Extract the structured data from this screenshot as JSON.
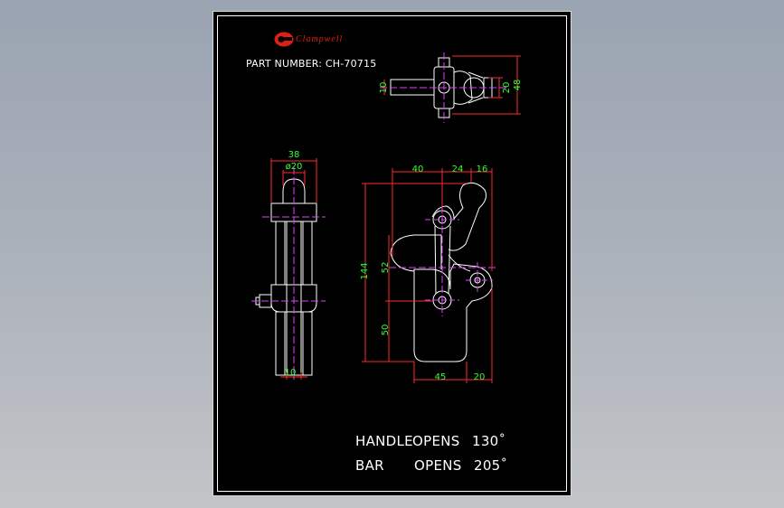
{
  "brand": {
    "name": "Clampwell",
    "color": "#e01f14"
  },
  "drawing": {
    "part_number_label": "PART NUMBER: CH-70715",
    "notes": [
      {
        "label": "HANDLE",
        "verb": "OPENS",
        "angle": "130˚"
      },
      {
        "label": "BAR",
        "verb": "OPENS",
        "angle": "205˚"
      }
    ]
  },
  "dimensions": {
    "top_view": {
      "width_10": "10",
      "height_20": "20",
      "height_48": "48"
    },
    "side_view": {
      "width_38": "38",
      "dia_20": "ø20",
      "width_10": "10"
    },
    "front_view": {
      "w_40": "40",
      "w_24": "24",
      "w_16": "16",
      "h_144": "144",
      "h_52": "52",
      "h_50": "50",
      "w_45": "45",
      "w_20": "20"
    }
  },
  "colors": {
    "outline": "#ffffff",
    "dimension": "#ff2a2a",
    "dimension_text": "#32ff32",
    "centerline": "#e040fb",
    "background": "#000000"
  }
}
